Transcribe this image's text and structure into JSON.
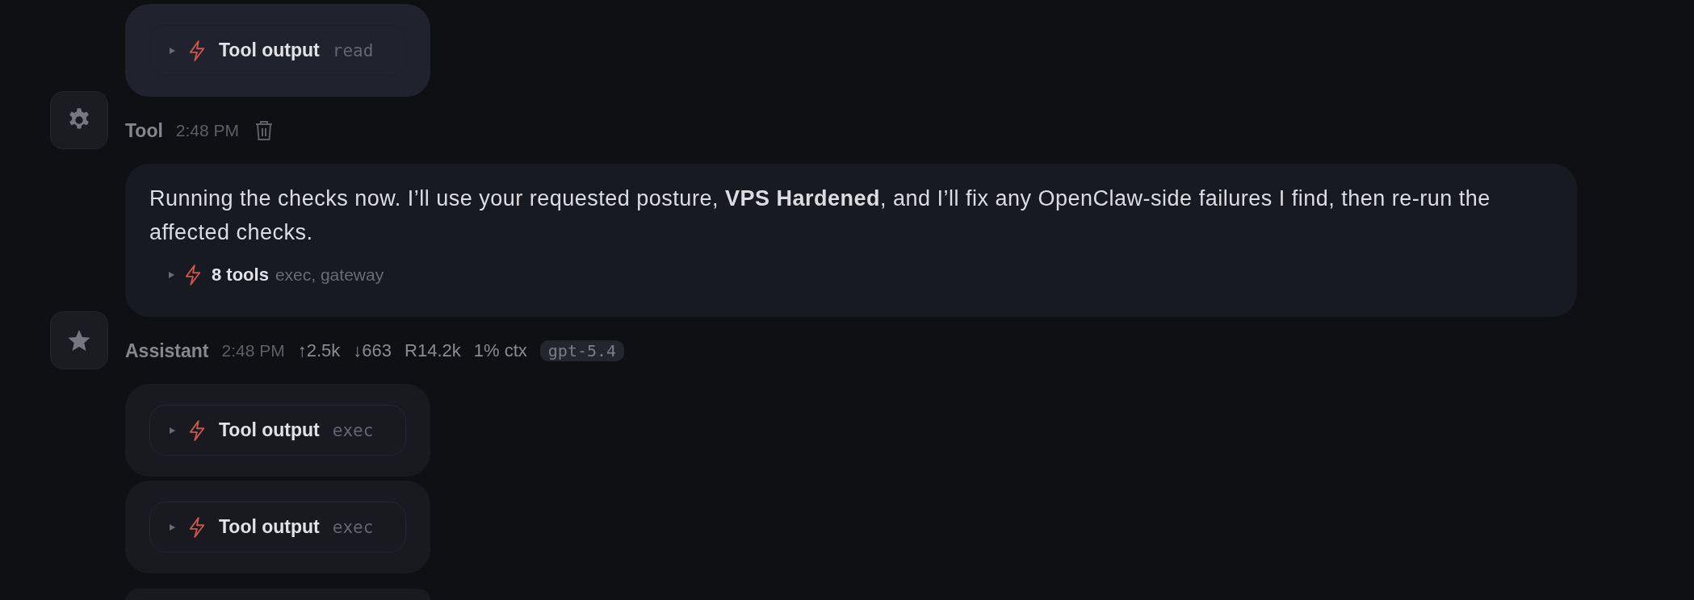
{
  "messages": [
    {
      "avatar": {
        "kind": "gear"
      },
      "groups": [
        {
          "kind": "tool-output",
          "label": "Tool output",
          "detail": "read",
          "highlighted": true
        }
      ],
      "meta": {
        "name": "Tool",
        "time": "2:48 PM",
        "deletable": true
      }
    },
    {
      "avatar": {
        "kind": "star"
      },
      "text": "Running the checks now. I’ll use your requested posture, **VPS Hardened**, and I’ll fix any OpenClaw-side failures I find, then re-run the affected checks.",
      "tools_summary": {
        "count": "8 tools",
        "names": "exec, gateway"
      },
      "meta": {
        "name": "Assistant",
        "time": "2:48 PM",
        "stats": [
          "↑2.5k",
          "↓663",
          "R14.2k",
          "1% ctx"
        ],
        "model": "gpt-5.4"
      }
    },
    {
      "groups": [
        {
          "kind": "tool-output",
          "label": "Tool output",
          "detail": "exec",
          "highlighted": false
        },
        {
          "kind": "tool-output",
          "label": "Tool output",
          "detail": "exec",
          "highlighted": false
        },
        {
          "kind": "cut-off",
          "highlighted": false
        }
      ]
    }
  ]
}
